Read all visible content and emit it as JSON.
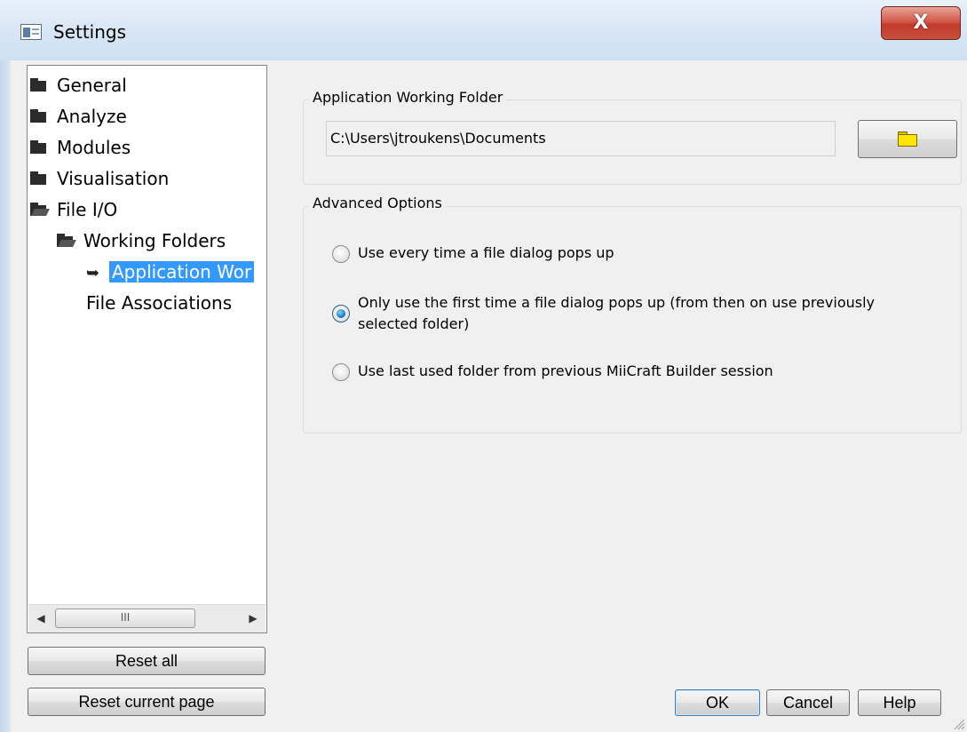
{
  "window": {
    "title": "Settings",
    "close_symbol": "X"
  },
  "tree": {
    "items": [
      {
        "label": "General",
        "icon": "folder-closed-icon"
      },
      {
        "label": "Analyze",
        "icon": "folder-closed-icon"
      },
      {
        "label": "Modules",
        "icon": "folder-closed-icon"
      },
      {
        "label": "Visualisation",
        "icon": "folder-closed-icon"
      },
      {
        "label": "File I/O",
        "icon": "folder-open-icon"
      },
      {
        "label": "Working Folders",
        "icon": "folder-open-icon"
      },
      {
        "label": "Application Wor",
        "icon": "arrow-icon",
        "selected": true
      },
      {
        "label": "File Associations",
        "icon": ""
      }
    ],
    "scroll_left": "◀",
    "scroll_right": "▶",
    "scroll_thumb_grip": "III"
  },
  "left_buttons": {
    "reset_all": "Reset all",
    "reset_current": "Reset current page"
  },
  "working_folder": {
    "group_title": "Application Working Folder",
    "path_value": "C:\\Users\\jtroukens\\Documents"
  },
  "advanced": {
    "group_title": "Advanced Options",
    "options": [
      {
        "label_line1": "Use every time a file dialog pops up",
        "label_line2": "",
        "checked": false
      },
      {
        "label_line1": "Only use the first time a file dialog pops up (from then on use previously",
        "label_line2": "selected folder)",
        "checked": true
      },
      {
        "label_line1": "Use last used folder from previous MiiCraft Builder session",
        "label_line2": "",
        "checked": false
      }
    ]
  },
  "dialog_buttons": {
    "ok": "OK",
    "cancel": "Cancel",
    "help": "Help"
  },
  "colors": {
    "selection": "#3399ff",
    "close_button": "#c9503f",
    "dialog_background": "#f0f0f0"
  }
}
